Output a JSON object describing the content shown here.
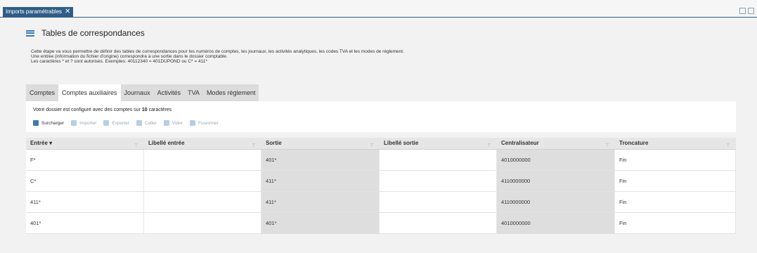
{
  "window": {
    "tab_label": "Imports paramétrables",
    "close_glyph": "✕"
  },
  "page": {
    "title": "Tables de correspondances",
    "description": [
      "Cette étape va vous permettre de définir des tables de correspondances pour les numéros de comptes, les journaux, les activités analytiques, les codes TVA et les modes de règlement.",
      "Une entrée (information du fichier d'origine) correspondra à une sortie dans le dossier comptable.",
      "Les caractères * et ? sont autorisés. Exemples: 40112340 = 401DUPOND ou C* = 411*"
    ]
  },
  "tabs": [
    "Comptes",
    "Comptes auxiliaires",
    "Journaux",
    "Activités",
    "TVA",
    "Modes règlement"
  ],
  "active_tab_index": 1,
  "info": {
    "prefix": "Votre dossier est configuré avec des comptes sur ",
    "count": "10",
    "suffix": " caractères"
  },
  "toolbar": {
    "surcharger": "Surcharger",
    "importer": "Importer",
    "exporter": "Exporter",
    "coller": "Coller",
    "vider": "Vider",
    "fusionner": "Fusionner"
  },
  "table": {
    "headers": [
      "Entrée ▾",
      "Libellé entrée",
      "Sortie",
      "Libellé sortie",
      "Centralisateur",
      "Troncature"
    ],
    "filter_glyph": "⊤",
    "rows": [
      [
        "F*",
        "",
        "401*",
        "",
        "4010000000",
        "Fin"
      ],
      [
        "C*",
        "",
        "411*",
        "",
        "4110000000",
        "Fin"
      ],
      [
        "411*",
        "",
        "411*",
        "",
        "4110000000",
        "Fin"
      ],
      [
        "401*",
        "",
        "401*",
        "",
        "4010000000",
        "Fin"
      ]
    ]
  },
  "colors": {
    "accent": "#3d79b6",
    "tab_bar": "#2f5d86",
    "readonly_cell": "#dedede"
  }
}
